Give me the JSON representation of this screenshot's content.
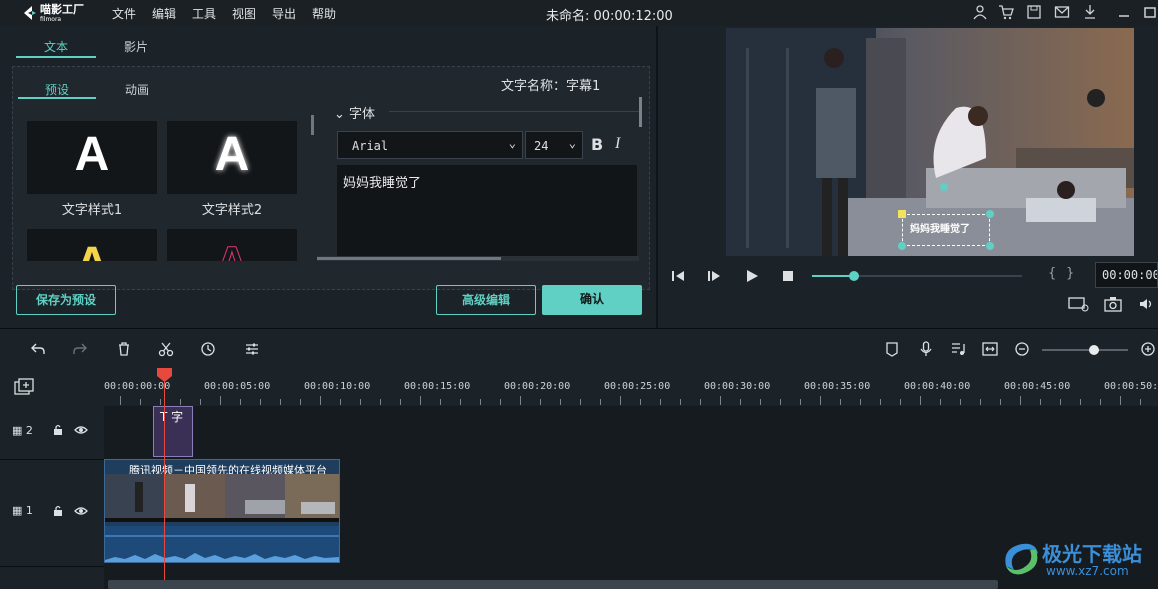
{
  "app": {
    "logo_text_top": "喵影工厂",
    "logo_text_bottom": "filmora",
    "title": "未命名: 00:00:12:00"
  },
  "menu": [
    "文件",
    "编辑",
    "工具",
    "视图",
    "导出",
    "帮助"
  ],
  "title_icons": [
    "user-icon",
    "cart-icon",
    "save-icon",
    "mail-icon",
    "download-icon",
    "minimize-icon"
  ],
  "left": {
    "tabs": [
      "文本",
      "影片"
    ],
    "subtabs": [
      "预设",
      "动画"
    ],
    "styles": [
      {
        "label": "文字样式1"
      },
      {
        "label": "文字样式2"
      }
    ],
    "text_name": "文字名称：字幕1",
    "font_section": "字体",
    "font_family": "Arial",
    "font_size": "24",
    "bold": "B",
    "italic": "I",
    "text_value": "妈妈我睡觉了",
    "buttons": {
      "save_preset": "保存为预设",
      "advanced": "高级编辑",
      "confirm": "确认"
    }
  },
  "preview": {
    "subtitle": "妈妈我睡觉了",
    "timecode": "00:00:00",
    "bracket_in": "{",
    "bracket_out": "}",
    "progress": 0.2
  },
  "timeline": {
    "ticks": [
      "00:00:00:00",
      "00:00:05:00",
      "00:00:10:00",
      "00:00:15:00",
      "00:00:20:00",
      "00:00:25:00",
      "00:00:30:00",
      "00:00:35:00",
      "00:00:40:00",
      "00:00:45:00",
      "00:00:50:00"
    ],
    "tracks": [
      {
        "num": "2"
      },
      {
        "num": "1"
      }
    ],
    "text_clip": "字",
    "video_clip": "腾讯视频－中国领先的在线视频媒体平台",
    "zoom": 0.6
  },
  "watermark": {
    "text": "极光下载站",
    "url": "www.xz7.com"
  },
  "colors": {
    "accent": "#5fd0c3",
    "playhead": "#e8493f"
  }
}
